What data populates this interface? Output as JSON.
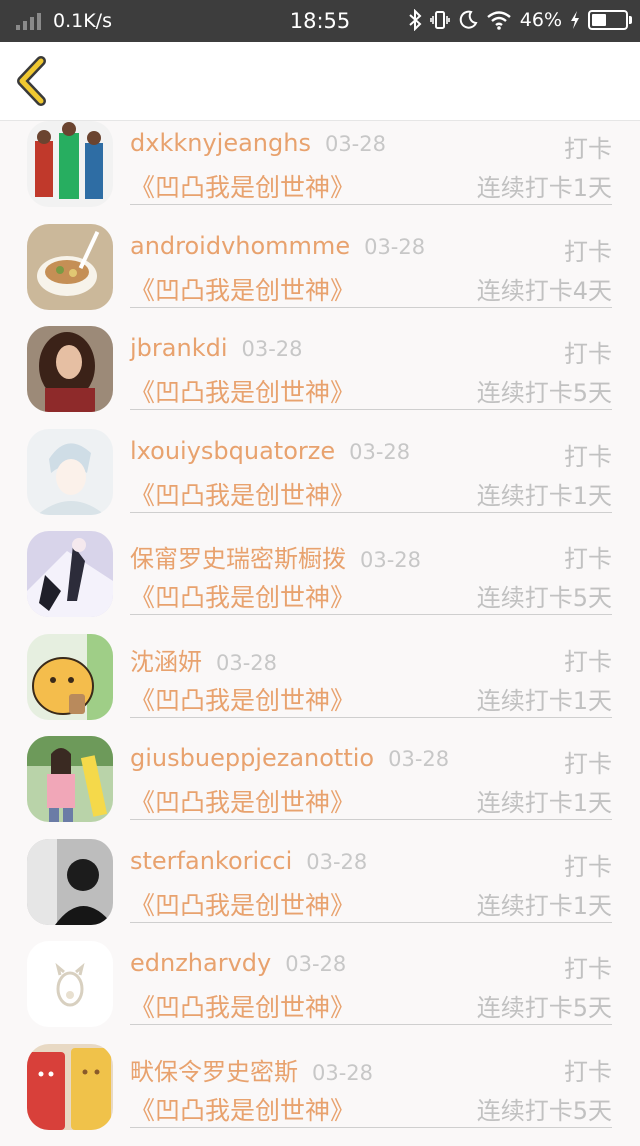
{
  "status_bar": {
    "network_speed": "0.1K/s",
    "time": "18:55",
    "battery": "46%"
  },
  "topbar": {
    "back_icon": "chevron-left-icon"
  },
  "entries": [
    {
      "username": "dxkknyjeanghs",
      "date": "03-28",
      "action": "打卡",
      "book": "《凹凸我是创世神》",
      "streak": "连续打卡1天",
      "avatar_color": "#6b8fb8"
    },
    {
      "username": "androidvhommme",
      "date": "03-28",
      "action": "打卡",
      "book": "《凹凸我是创世神》",
      "streak": "连续打卡4天",
      "avatar_color": "#d9c7a8"
    },
    {
      "username": "jbrankdi",
      "date": "03-28",
      "action": "打卡",
      "book": "《凹凸我是创世神》",
      "streak": "连续打卡5天",
      "avatar_color": "#7a4a3a"
    },
    {
      "username": "lxouiysbquatorze",
      "date": "03-28",
      "action": "打卡",
      "book": "《凹凸我是创世神》",
      "streak": "连续打卡1天",
      "avatar_color": "#dfe6ea"
    },
    {
      "username": "保甯罗史瑞密斯橱拨",
      "date": "03-28",
      "action": "打卡",
      "book": "《凹凸我是创世神》",
      "streak": "连续打卡5天",
      "avatar_color": "#b9b4d6"
    },
    {
      "username": "沈涵妍",
      "date": "03-28",
      "action": "打卡",
      "book": "《凹凸我是创世神》",
      "streak": "连续打卡1天",
      "avatar_color": "#f2c866"
    },
    {
      "username": "giusbueppjezanottio",
      "date": "03-28",
      "action": "打卡",
      "book": "《凹凸我是创世神》",
      "streak": "连续打卡1天",
      "avatar_color": "#a7c7a0"
    },
    {
      "username": "sterfankoricci",
      "date": "03-28",
      "action": "打卡",
      "book": "《凹凸我是创世神》",
      "streak": "连续打卡1天",
      "avatar_color": "#3a3a3a"
    },
    {
      "username": "ednzharvdy",
      "date": "03-28",
      "action": "打卡",
      "book": "《凹凸我是创世神》",
      "streak": "连续打卡5天",
      "avatar_color": "#ffffff"
    },
    {
      "username": "畎保令罗史密斯",
      "date": "03-28",
      "action": "打卡",
      "book": "《凹凸我是创世神》",
      "streak": "连续打卡5天",
      "avatar_color": "#d8403a"
    }
  ]
}
